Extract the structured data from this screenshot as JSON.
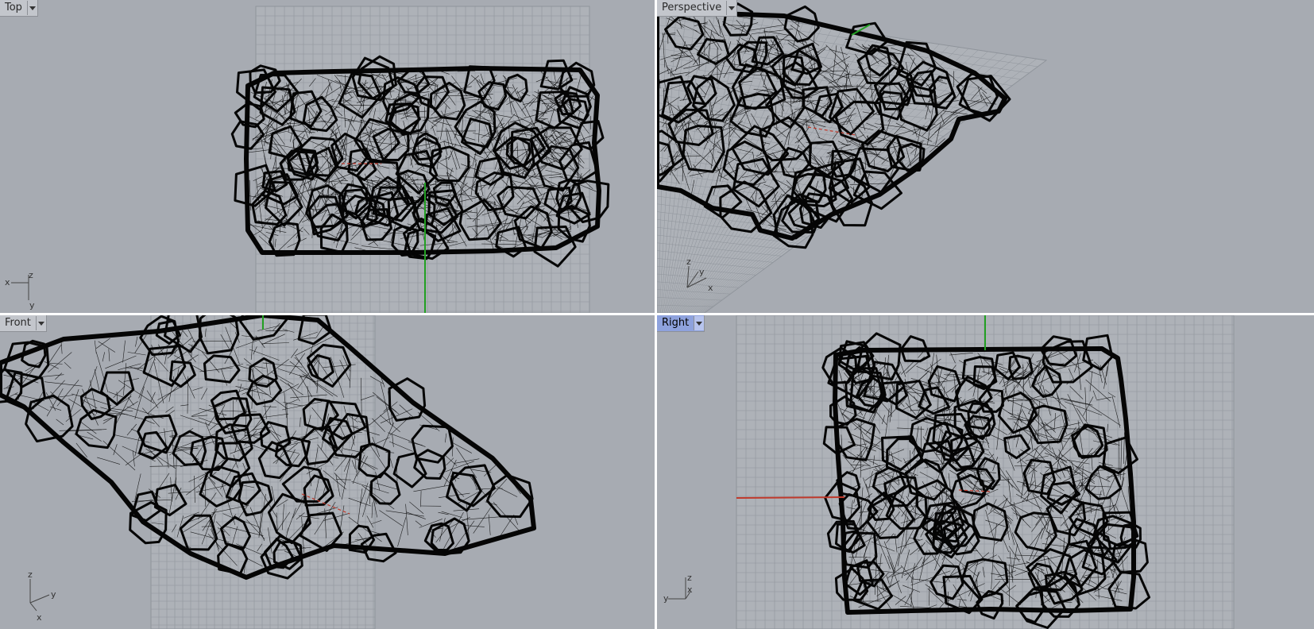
{
  "viewports": {
    "top": {
      "title": "Top",
      "axis_labels": [
        "x",
        "z",
        "y"
      ]
    },
    "perspective": {
      "title": "Perspective",
      "axis_labels": [
        "z",
        "y",
        "x"
      ]
    },
    "front": {
      "title": "Front",
      "axis_labels": [
        "z",
        "y",
        "x"
      ]
    },
    "right": {
      "title": "Right",
      "axis_labels": [
        "z",
        "y",
        "x"
      ],
      "active": true
    }
  },
  "colors": {
    "viewport_bg": "#a7abb2",
    "grid_line": "#8f949b",
    "mesh": "#050505",
    "x_axis": "#c0392b",
    "y_axis": "#22a022",
    "active_tab": "#8ea2dd"
  }
}
